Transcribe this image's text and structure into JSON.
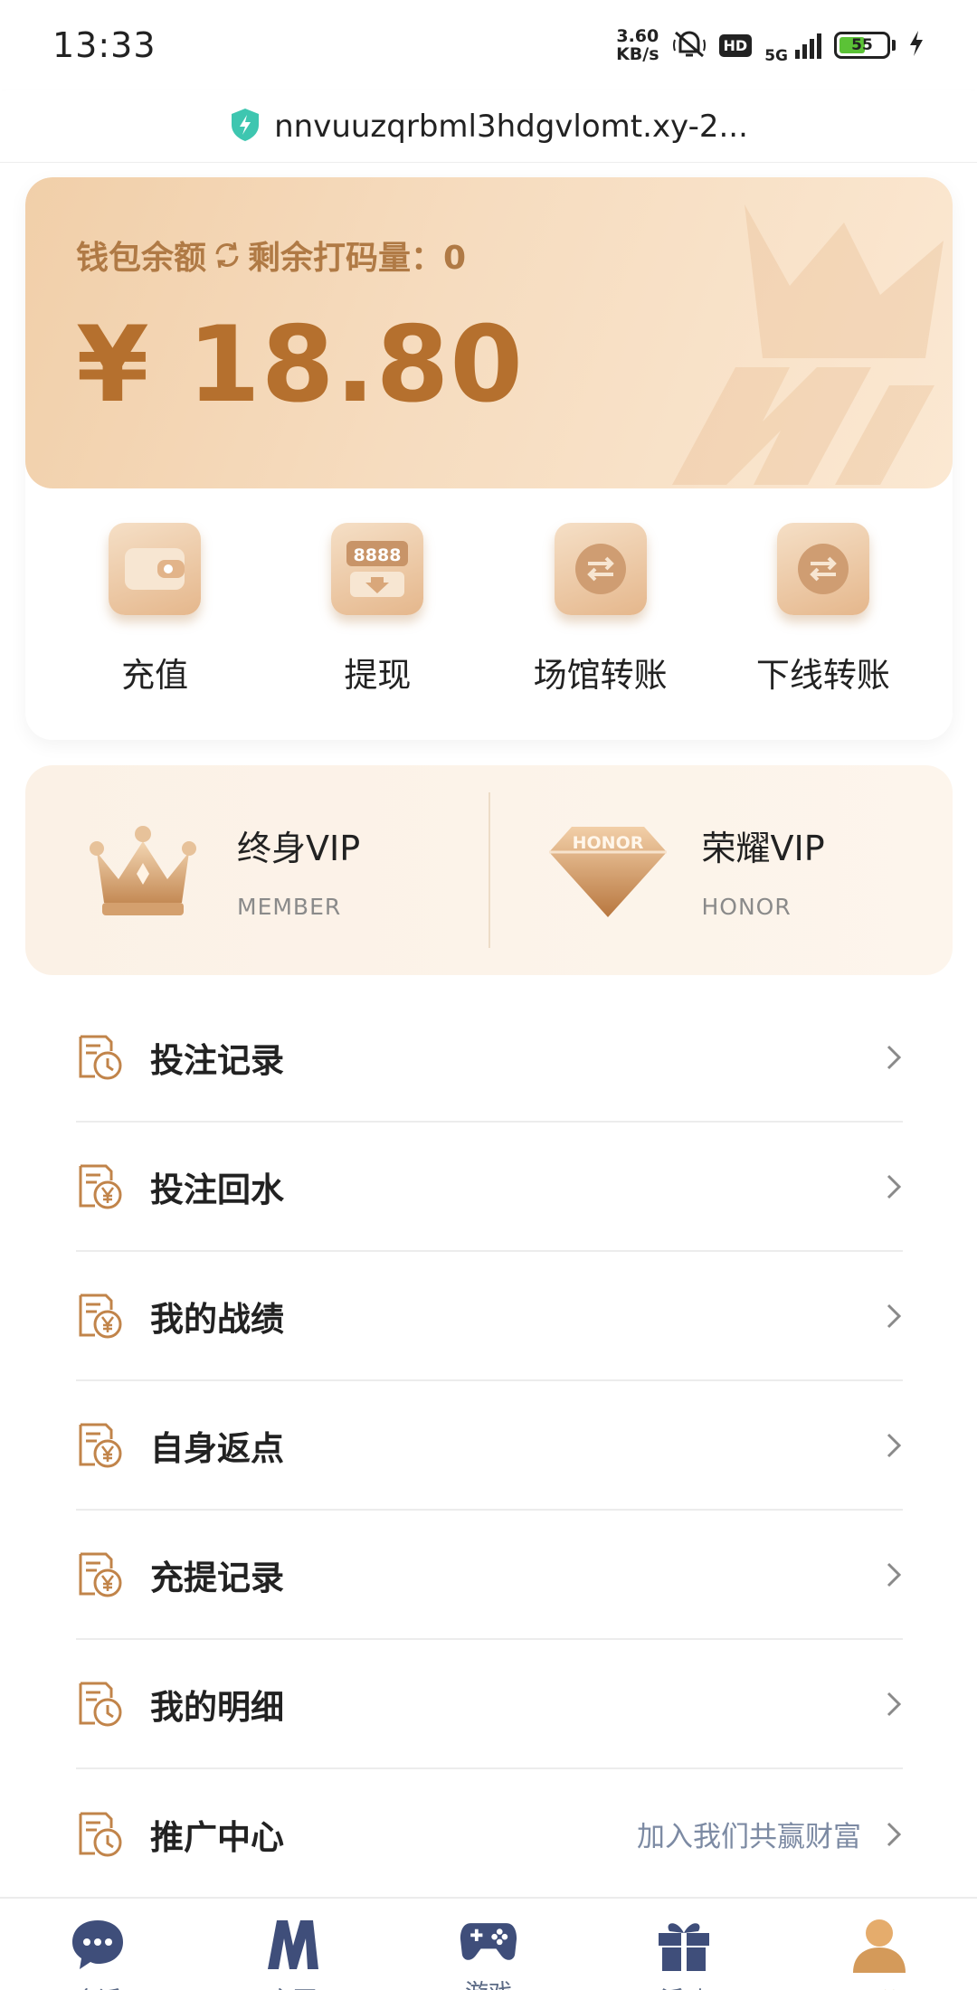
{
  "status_bar": {
    "time": "13:33",
    "net_speed_value": "3.60",
    "net_speed_unit": "KB/s",
    "hd": "HD",
    "network": "5G",
    "battery": "55"
  },
  "browser": {
    "url": "nnvuuzqrbml3hdgvlomt.xy-2..."
  },
  "wallet": {
    "label": "钱包余额",
    "remaining_label": "剩余打码量：0",
    "amount": "¥ 18.80"
  },
  "quick_actions": [
    {
      "label": "充值",
      "icon": "wallet-icon"
    },
    {
      "label": "提现",
      "icon": "withdraw-icon"
    },
    {
      "label": "场馆转账",
      "icon": "venue-transfer-icon"
    },
    {
      "label": "下线转账",
      "icon": "downline-transfer-icon"
    }
  ],
  "vip": [
    {
      "title": "终身VIP",
      "subtitle": "MEMBER",
      "icon": "crown-icon"
    },
    {
      "title": "荣耀VIP",
      "subtitle": "HONOR",
      "icon": "honor-diamond-icon",
      "badge_text": "HONOR"
    }
  ],
  "menu": [
    {
      "label": "投注记录",
      "icon": "clock-doc-icon",
      "extra": ""
    },
    {
      "label": "投注回水",
      "icon": "yen-doc-icon",
      "extra": ""
    },
    {
      "label": "我的战绩",
      "icon": "yen-doc-icon",
      "extra": ""
    },
    {
      "label": "自身返点",
      "icon": "yen-doc-icon",
      "extra": ""
    },
    {
      "label": "充提记录",
      "icon": "yen-doc-icon",
      "extra": ""
    },
    {
      "label": "我的明细",
      "icon": "clock-doc-icon",
      "extra": ""
    },
    {
      "label": "推广中心",
      "icon": "clock-doc-icon",
      "extra": "加入我们共赢财富"
    }
  ],
  "withdraw_icon_text": "8888",
  "bottom_nav": [
    {
      "label": "会话",
      "icon": "chat-icon",
      "active": false
    },
    {
      "label": "主页",
      "icon": "home-m-icon",
      "active": false
    },
    {
      "label": "游戏",
      "icon": "gamepad-icon",
      "active": false
    },
    {
      "label": "活动",
      "icon": "gift-icon",
      "active": false
    },
    {
      "label": "我的",
      "icon": "profile-icon",
      "active": true
    }
  ],
  "colors": {
    "accent": "#b5702e",
    "wallet_gradient_start": "#f1cfa9",
    "wallet_gradient_end": "#fbe8d2",
    "menu_icon": "#c1844a",
    "nav_icon": "#3f4e7a",
    "nav_active": "#d49a5a"
  }
}
